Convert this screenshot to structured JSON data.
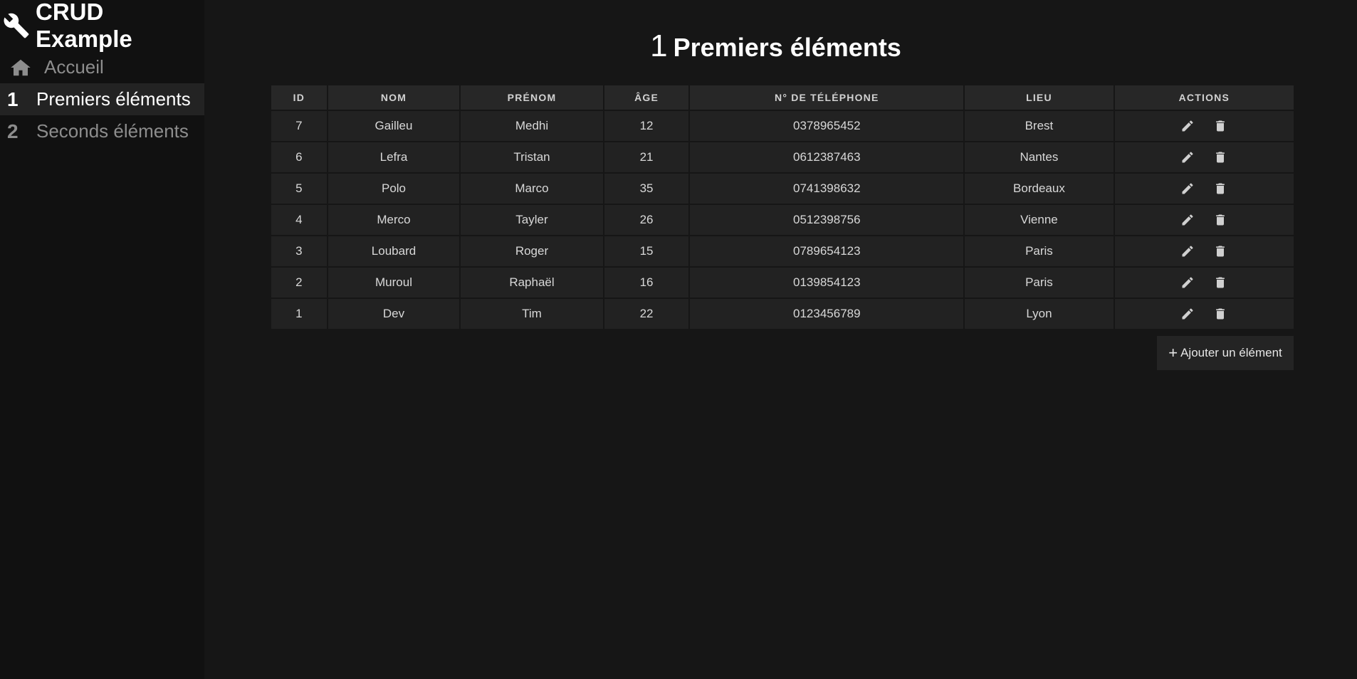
{
  "app": {
    "title": "CRUD Example"
  },
  "sidebar": {
    "items": [
      {
        "label": "Accueil",
        "icon": "home-icon"
      },
      {
        "num": "1",
        "label": "Premiers éléments",
        "active": true
      },
      {
        "num": "2",
        "label": "Seconds éléments"
      }
    ]
  },
  "page": {
    "title_num": "1",
    "title": "Premiers éléments"
  },
  "table": {
    "headers": [
      "ID",
      "Nom",
      "Prénom",
      "Âge",
      "N° de téléphone",
      "Lieu",
      "Actions"
    ],
    "rows": [
      [
        "7",
        "Gailleu",
        "Medhi",
        "12",
        "0378965452",
        "Brest"
      ],
      [
        "6",
        "Lefra",
        "Tristan",
        "21",
        "0612387463",
        "Nantes"
      ],
      [
        "5",
        "Polo",
        "Marco",
        "35",
        "0741398632",
        "Bordeaux"
      ],
      [
        "4",
        "Merco",
        "Tayler",
        "26",
        "0512398756",
        "Vienne"
      ],
      [
        "3",
        "Loubard",
        "Roger",
        "15",
        "0789654123",
        "Paris"
      ],
      [
        "2",
        "Muroul",
        "Raphaël",
        "16",
        "0139854123",
        "Paris"
      ],
      [
        "1",
        "Dev",
        "Tim",
        "22",
        "0123456789",
        "Lyon"
      ]
    ],
    "row_actions": [
      "edit-icon",
      "delete-icon"
    ]
  },
  "add_button": {
    "plus": "+",
    "label": "Ajouter un élément"
  },
  "colors": {
    "background": "#161616",
    "sidebar": "#111111",
    "active_item": "#232323",
    "cell": "#222222",
    "header": "#272727"
  }
}
